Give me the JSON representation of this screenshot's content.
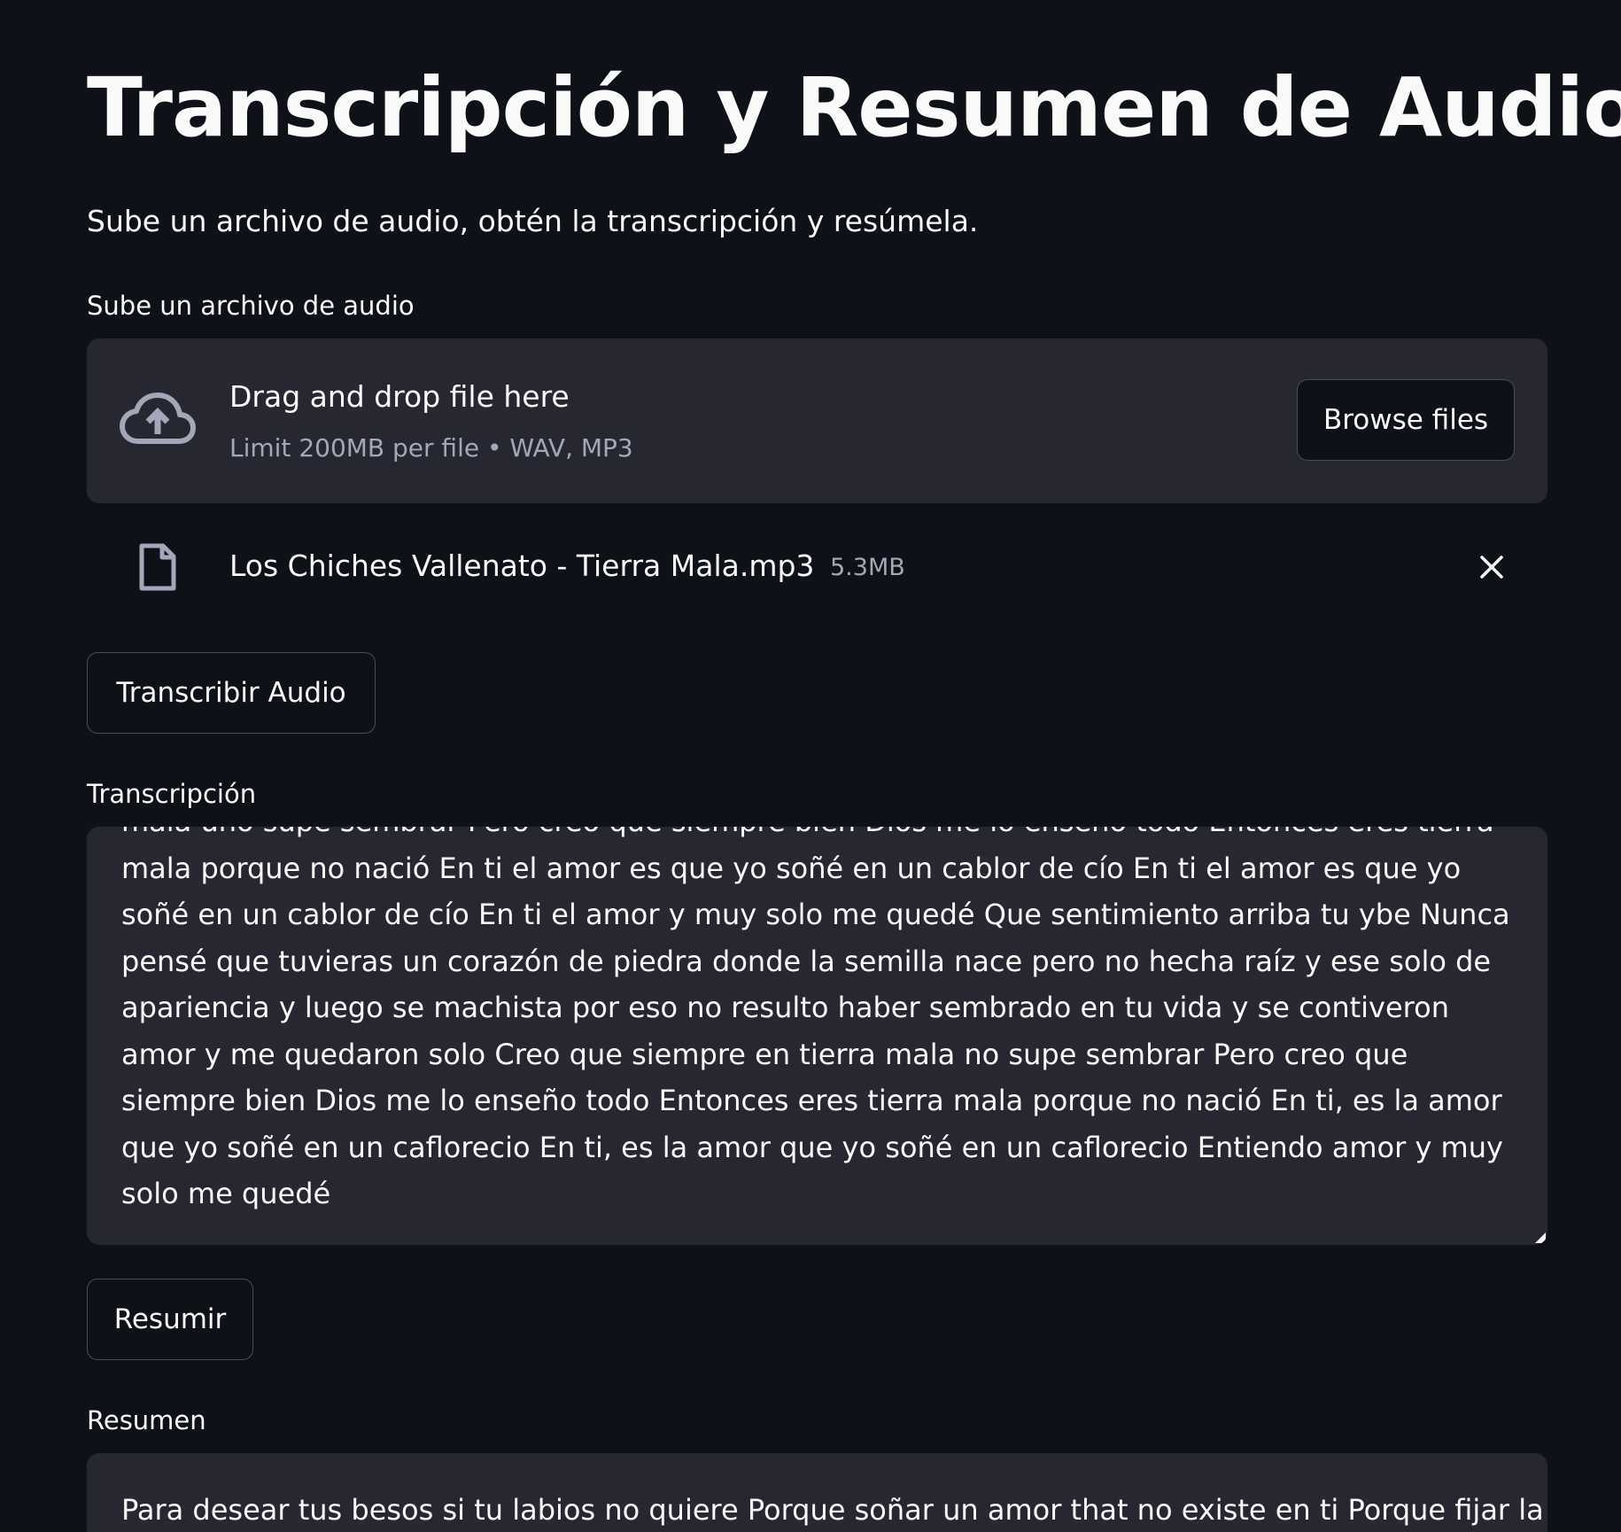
{
  "page": {
    "title": "Transcripción y Resumen de Audio",
    "subtitle": "Sube un archivo de audio, obtén la transcripción y resúmela."
  },
  "uploader": {
    "label": "Sube un archivo de audio",
    "drag_text": "Drag and drop file here",
    "limit_text": "Limit 200MB per file • WAV, MP3",
    "browse_label": "Browse files",
    "icon": "cloud-upload-icon"
  },
  "uploaded_file": {
    "name": "Los Chiches Vallenato - Tierra Mala.mp3",
    "size": "5.3MB",
    "icon": "file-icon",
    "remove_icon": "close-icon"
  },
  "transcribe_button": {
    "label": "Transcribir Audio"
  },
  "transcription": {
    "label": "Transcripción",
    "text": "mala uno supe sembrar Pero creo que siempre bien Dios me lo enseño todo Entonces eres tierra mala porque no nació En ti el amor es que yo soñé en un cablor de cío En ti el amor es que yo soñé en un cablor de cío En ti el amor y muy solo me quedé Que sentimiento arriba tu ybe Nunca pensé que tuvieras un corazón de piedra donde la semilla nace pero no hecha raíz y ese solo de apariencia y luego se machista por eso no resulto haber sembrado en tu vida y se contiveron amor y me quedaron solo Creo que siempre en tierra mala no supe sembrar Pero creo que siempre bien Dios me lo enseño todo Entonces eres tierra mala porque no nació En ti, es la amor que yo soñé en un caflorecio En ti, es la amor que yo soñé en un caflorecio Entiendo amor y muy solo me quedé"
  },
  "summarize_button": {
    "label": "Resumir"
  },
  "summary": {
    "label": "Resumen",
    "text": "Para desear tus besos si tu labios no quiere Porque soñar un amor that no existe en ti Porque fijar la"
  },
  "colors": {
    "background": "#0e1117",
    "panel": "#262730",
    "text": "#fafafa",
    "muted": "#a3a8b8",
    "border": "#4a4d57"
  }
}
